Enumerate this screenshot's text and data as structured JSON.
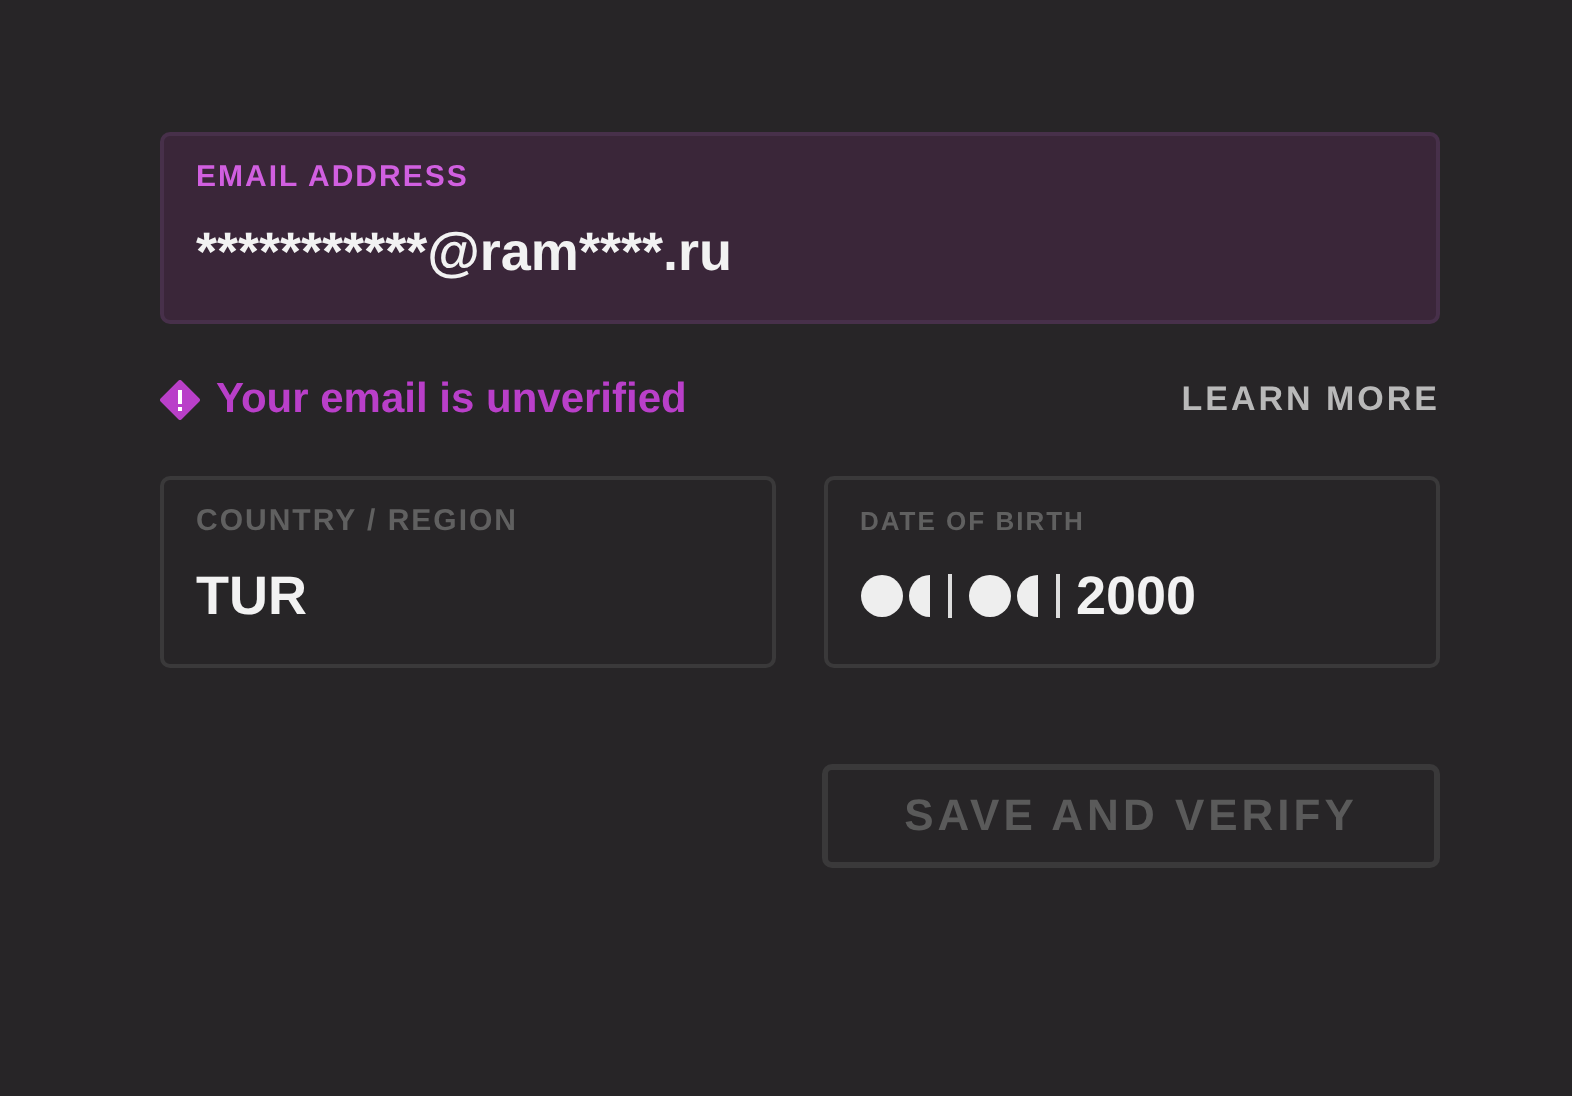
{
  "email": {
    "label": "EMAIL ADDRESS",
    "value": "***********@ram****.ru"
  },
  "verification": {
    "message": "Your email is unverified",
    "link": "LEARN MORE"
  },
  "country": {
    "label": "COUNTRY / REGION",
    "value": "TUR"
  },
  "birth_date": {
    "label": "DATE OF BIRTH",
    "year": "2000"
  },
  "save_button": {
    "label": "SAVE AND VERIFY",
    "disabled": true
  }
}
